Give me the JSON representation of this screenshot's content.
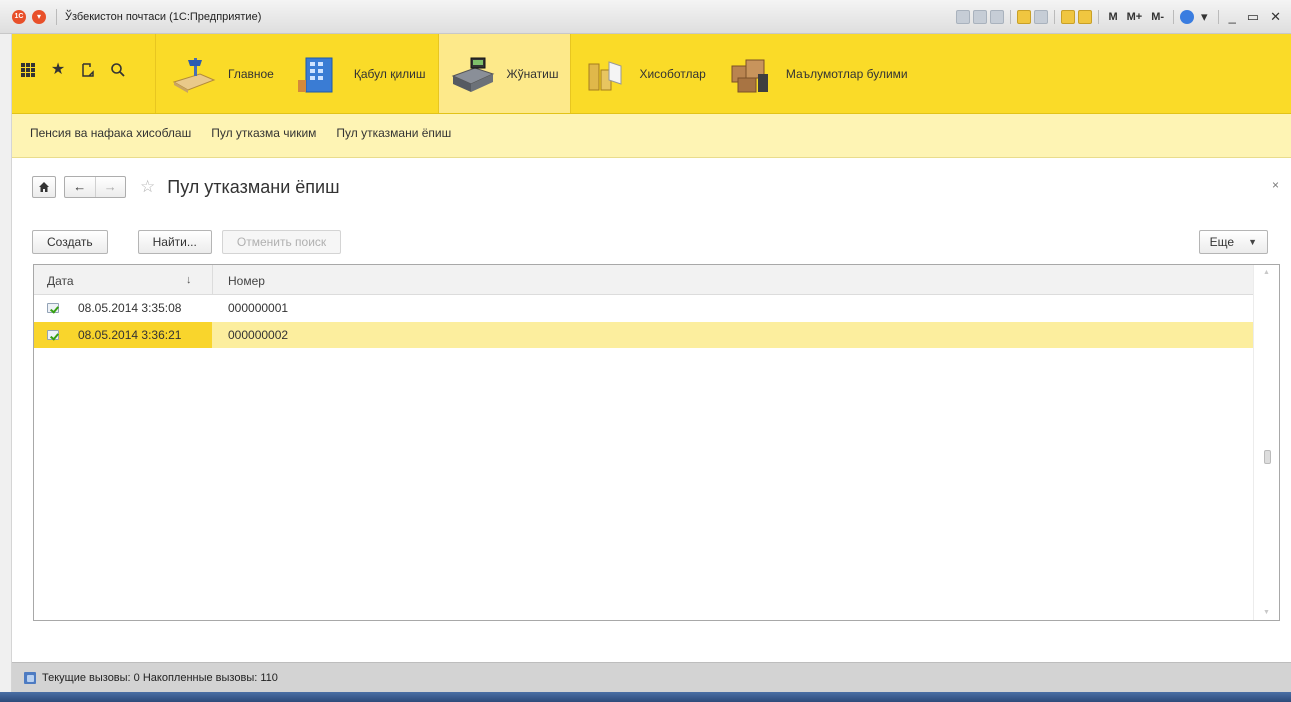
{
  "window": {
    "title": "Ўзбекистон почтаси  (1С:Предприятие)",
    "logo_text": "1С",
    "toolbar_buttons": [
      "M",
      "M+",
      "M-"
    ],
    "window_controls": [
      "_",
      "▭",
      "✕"
    ]
  },
  "nav": {
    "quick_icons": [
      "apps-grid-icon",
      "favorites-star-icon",
      "history-icon",
      "search-icon"
    ],
    "sections": [
      {
        "label": "Главное",
        "icon": "home-desk-icon",
        "active": false
      },
      {
        "label": "Қабул қилиш",
        "icon": "building-icon",
        "active": false
      },
      {
        "label": "Жўнатиш",
        "icon": "cash-register-icon",
        "active": true
      },
      {
        "label": "Хисоботлар",
        "icon": "coins-icon",
        "active": false
      },
      {
        "label": "Маълумотлар булими",
        "icon": "boxes-icon",
        "active": false
      }
    ]
  },
  "subnav": {
    "links": [
      "Пенсия ва нафака хисоблаш",
      "Пул утказма чиким",
      "Пул утказмани ёпиш"
    ]
  },
  "form": {
    "title": "Пул утказмани ёпиш",
    "close": "×",
    "buttons": {
      "create": "Создать",
      "find": "Найти...",
      "cancel_search": "Отменить поиск",
      "more": "Еще"
    }
  },
  "table": {
    "columns": {
      "date": "Дата",
      "number": "Номер"
    },
    "sort_indicator": "↓",
    "rows": [
      {
        "date": "08.05.2014 3:35:08",
        "number": "000000001",
        "selected": false
      },
      {
        "date": "08.05.2014 3:36:21",
        "number": "000000002",
        "selected": true
      }
    ]
  },
  "status": {
    "text": "Текущие вызовы: 0   Накопленные вызовы: 110"
  },
  "colors": {
    "nav_yellow": "#fadb28",
    "subnav_yellow": "#fef4b4",
    "selected_row": "#fcee9e",
    "selected_cell": "#f9d52c"
  }
}
